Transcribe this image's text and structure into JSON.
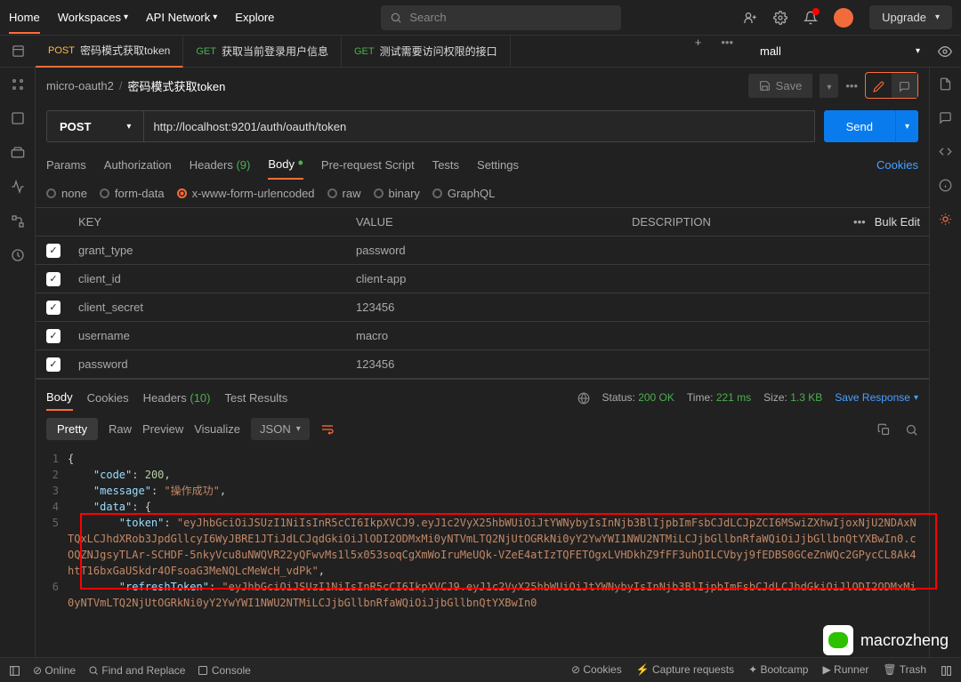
{
  "topbar": {
    "home": "Home",
    "workspaces": "Workspaces",
    "api_network": "API Network",
    "explore": "Explore",
    "search_placeholder": "Search",
    "upgrade": "Upgrade"
  },
  "tabs": [
    {
      "method": "POST",
      "label": "密码模式获取token",
      "active": true
    },
    {
      "method": "GET",
      "label": "获取当前登录用户信息",
      "active": false
    },
    {
      "method": "GET",
      "label": "测试需要访问权限的接口",
      "active": false
    }
  ],
  "environment": "mall",
  "breadcrumb": {
    "parent": "micro-oauth2",
    "current": "密码模式获取token"
  },
  "save_label": "Save",
  "request": {
    "method": "POST",
    "url": "http://localhost:9201/auth/oauth/token",
    "send": "Send"
  },
  "request_tabs": {
    "params": "Params",
    "authorization": "Authorization",
    "headers": "Headers",
    "headers_count": "(9)",
    "body": "Body",
    "pre_request": "Pre-request Script",
    "tests": "Tests",
    "settings": "Settings",
    "cookies": "Cookies"
  },
  "body_types": {
    "none": "none",
    "form_data": "form-data",
    "urlencoded": "x-www-form-urlencoded",
    "raw": "raw",
    "binary": "binary",
    "graphql": "GraphQL"
  },
  "table": {
    "headers": {
      "key": "KEY",
      "value": "VALUE",
      "description": "DESCRIPTION",
      "bulk": "Bulk Edit"
    },
    "rows": [
      {
        "key": "grant_type",
        "value": "password"
      },
      {
        "key": "client_id",
        "value": "client-app"
      },
      {
        "key": "client_secret",
        "value": "123456"
      },
      {
        "key": "username",
        "value": "macro"
      },
      {
        "key": "password",
        "value": "123456"
      }
    ]
  },
  "response_tabs": {
    "body": "Body",
    "cookies": "Cookies",
    "headers": "Headers",
    "headers_count": "(10)",
    "test_results": "Test Results"
  },
  "status": {
    "label": "Status:",
    "value": "200 OK",
    "time_label": "Time:",
    "time": "221 ms",
    "size_label": "Size:",
    "size": "1.3 KB",
    "save_response": "Save Response"
  },
  "view_modes": {
    "pretty": "Pretty",
    "raw": "Raw",
    "preview": "Preview",
    "visualize": "Visualize",
    "format": "JSON"
  },
  "response_body": {
    "code": 200,
    "message": "操作成功",
    "token_key": "token",
    "token_val": "eyJhbGciOiJSUzI1NiIsInR5cCI6IkpXVCJ9.eyJ1c2VyX25hbWUiOiJtYWNybyIsInNjb3BlIjpbImFsbCJdLCJpZCI6MSwiZXhwIjoxNjU2NDAxNTQxLCJhdXRob3JpdGllcyI6WyJBRE1JTiJdLCJqdGkiOiJlODI2ODMxMi0yNTVmLTQ2NjUtOGRkNi0yY2YwYWI1NWU2NTMiLCJjbGllbnRfaWQiOiJjbGllbnQtYXBwIn0.cOQZNJgsyTLAr-SCHDF-5nkyVcu8uNWQVR22yQFwvMs1l5x053soqCgXmWoIruMeUQk-VZeE4atIzTQFETOgxLVHDkhZ9fFF3uhOILCVbyj9fEDBS0GCeZnWQc2GPycCL8Ak4htT16bxGaUSkdr4OFsoaG3MeNQLcMeWcH_vdPk",
    "refresh_key": "refreshToken",
    "refresh_val": "eyJhbGciOiJSUzI1NiIsInR5cCI6IkpXVCJ9.eyJ1c2VyX25hbWUiOiJtYWNybyIsInNjb3BlIjpbImFsbCJdLCJhdGkiOiJlODI2ODMxMi0yNTVmLTQ2NjUtOGRkNi0yY2YwYWI1NWU2NTMiLCJjbGllbnRfaWQiOiJjbGllbnQtYXBwIn0"
  },
  "footer": {
    "online": "Online",
    "find": "Find and Replace",
    "console": "Console",
    "cookies": "Cookies",
    "capture": "Capture requests",
    "bootcamp": "Bootcamp",
    "runner": "Runner",
    "trash": "Trash"
  },
  "watermark": "macrozheng"
}
